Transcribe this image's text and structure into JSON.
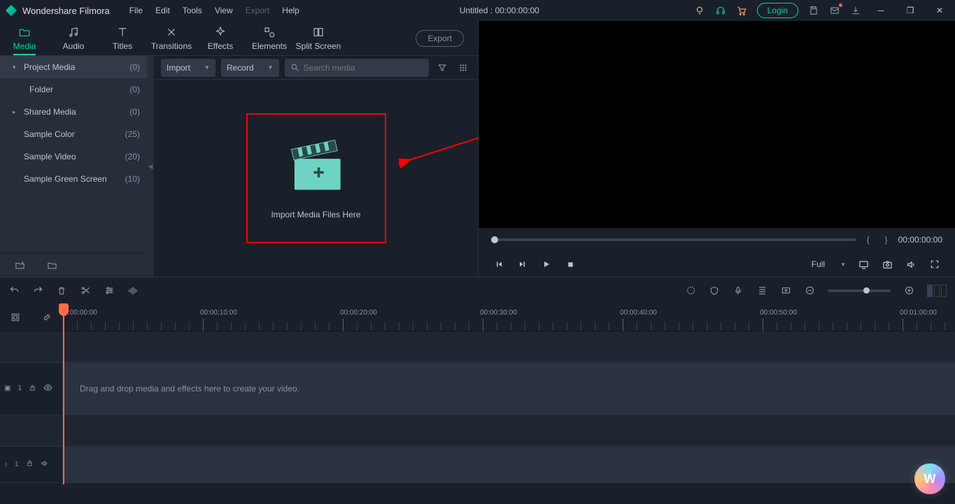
{
  "app_name": "Wondershare Filmora",
  "menus": [
    "File",
    "Edit",
    "Tools",
    "View",
    "Export",
    "Help"
  ],
  "menu_disabled_index": 4,
  "title_center": "Untitled : 00:00:00:00",
  "login_label": "Login",
  "tabs": [
    {
      "label": "Media"
    },
    {
      "label": "Audio"
    },
    {
      "label": "Titles"
    },
    {
      "label": "Transitions"
    },
    {
      "label": "Effects"
    },
    {
      "label": "Elements"
    },
    {
      "label": "Split Screen"
    }
  ],
  "export_label": "Export",
  "sidebar": {
    "items": [
      {
        "label": "Project Media",
        "count": "(0)",
        "level": 0,
        "chev": "▾"
      },
      {
        "label": "Folder",
        "count": "(0)",
        "level": 1,
        "chev": ""
      },
      {
        "label": "Shared Media",
        "count": "(0)",
        "level": 0,
        "chev": "▸"
      },
      {
        "label": "Sample Color",
        "count": "(25)",
        "level": 0,
        "chev": ""
      },
      {
        "label": "Sample Video",
        "count": "(20)",
        "level": 0,
        "chev": ""
      },
      {
        "label": "Sample Green Screen",
        "count": "(10)",
        "level": 0,
        "chev": ""
      }
    ]
  },
  "import_label": "Import",
  "record_label": "Record",
  "search_placeholder": "Search media",
  "drop_text": "Import Media Files Here",
  "preview": {
    "brackets_left": "{",
    "brackets_right": "}",
    "time": "00:00:00:00",
    "quality_label": "Full"
  },
  "timeline": {
    "majors": [
      "00:00:00:00",
      "00:00:10:00",
      "00:00:20:00",
      "00:00:30:00",
      "00:00:40:00",
      "00:00:50:00",
      "00:01:00:00"
    ],
    "drop_hint": "Drag and drop media and effects here to create your video.",
    "video_track_label": "1",
    "audio_track_label": "1"
  },
  "brand_letter": "W"
}
